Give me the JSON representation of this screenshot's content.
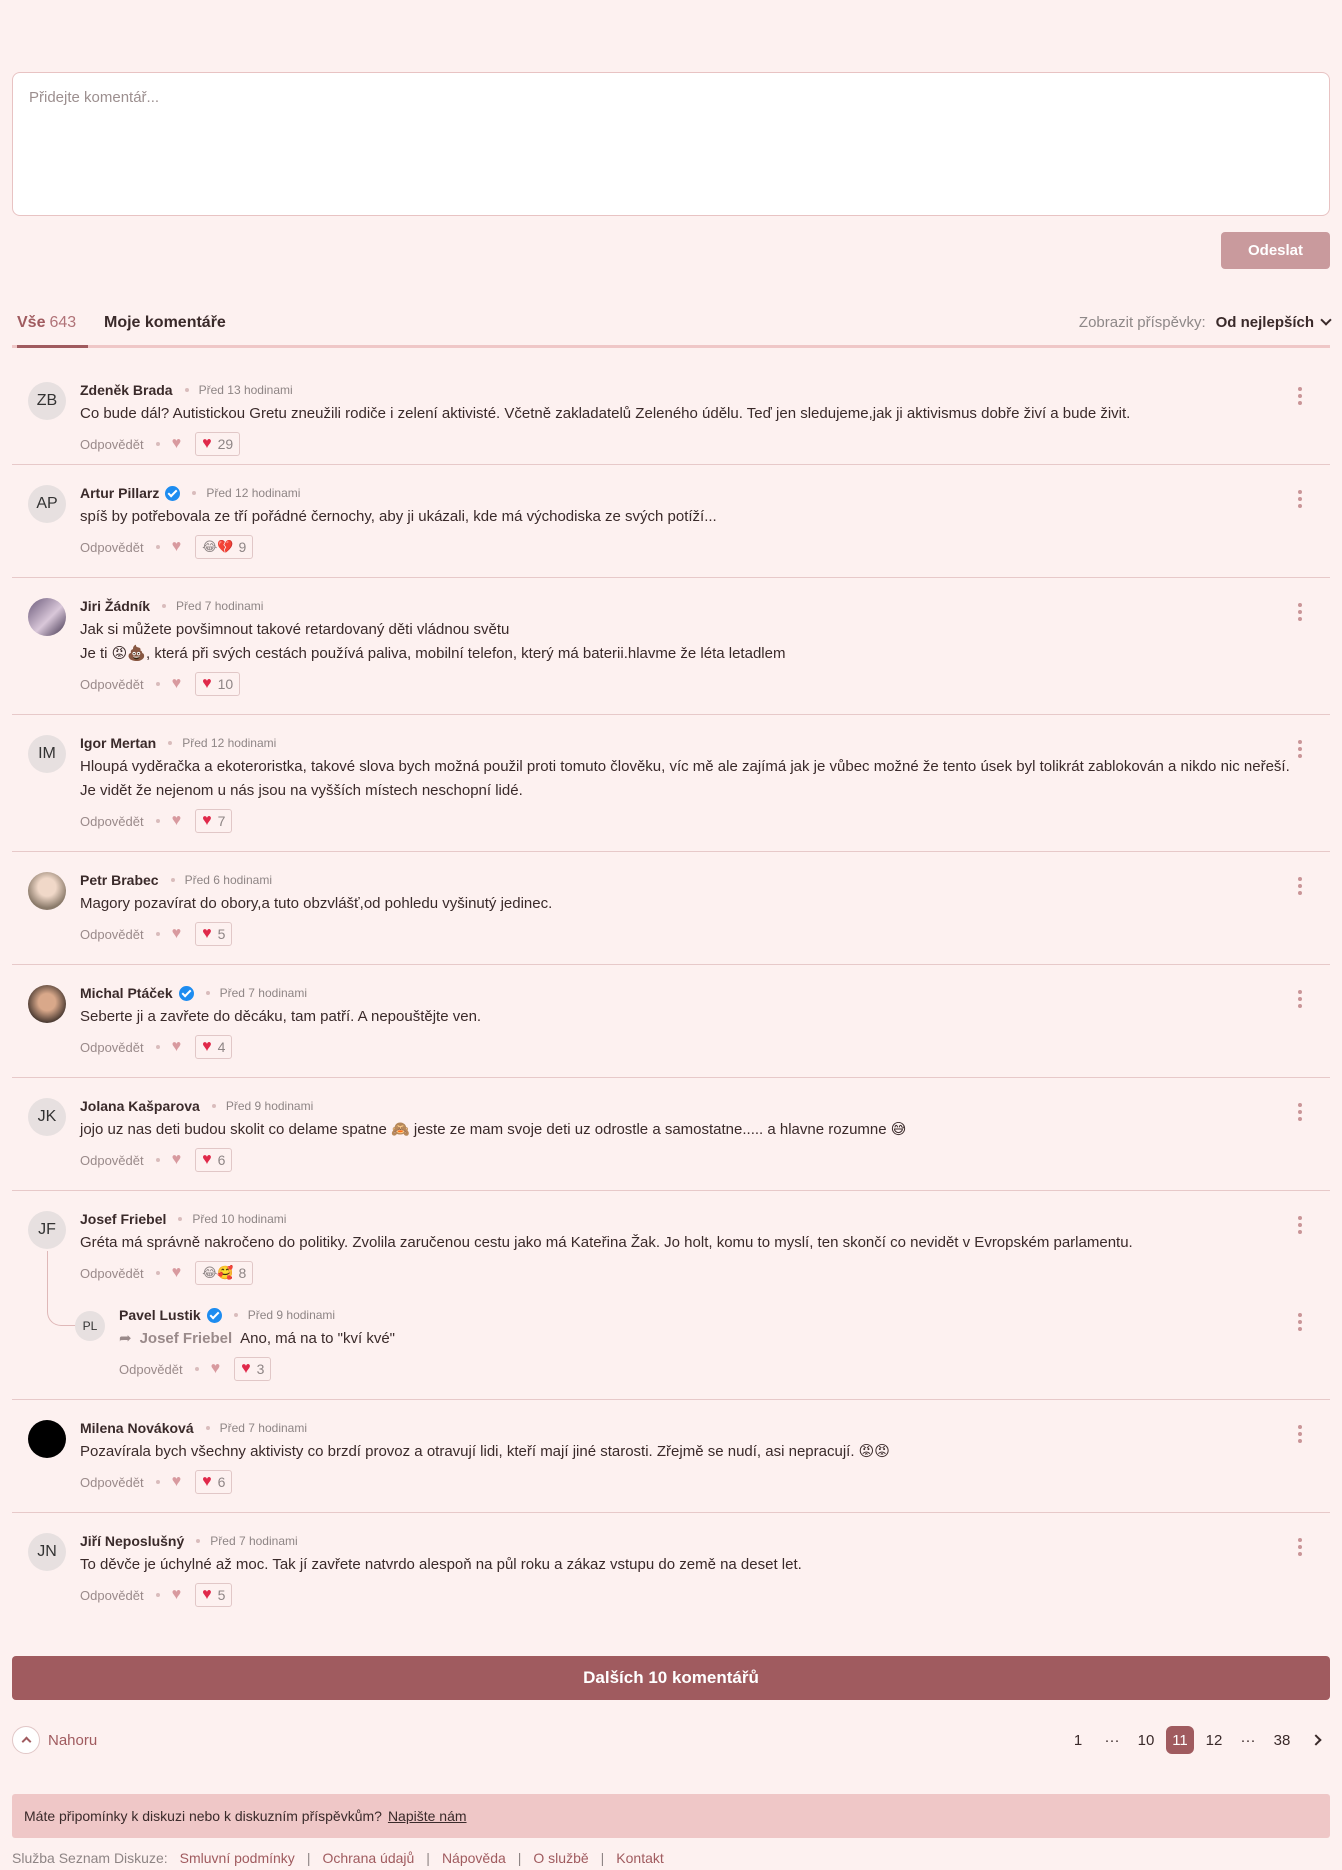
{
  "composer": {
    "placeholder": "Přidejte komentář...",
    "send_label": "Odeslat"
  },
  "tabs": {
    "all_label": "Vše",
    "all_count": "643",
    "mine_label": "Moje komentáře"
  },
  "sort": {
    "label": "Zobrazit příspěvky:",
    "value": "Od nejlepších"
  },
  "comments": [
    {
      "initials": "ZB",
      "name": "Zdeněk Brada",
      "verified": false,
      "time": "Před 13 hodinami",
      "text": [
        "Co bude dál? Autistickou Gretu zneužili rodiče i zelení aktivisté. Včetně zakladatelů Zeleného údělu. Teď jen sledujeme,jak ji aktivismus dobře živí a bude živit."
      ],
      "reply": "Odpovědět",
      "reaction_icons": "heart",
      "reaction_count": "29"
    },
    {
      "initials": "AP",
      "name": "Artur Pillarz",
      "verified": true,
      "time": "Před 12 hodinami",
      "text": [
        "spíš by potřebovala ze tří pořádné černochy, aby ji ukázali, kde má východiska ze svých potíží..."
      ],
      "reply": "Odpovědět",
      "reaction_icons": "😂💔",
      "reaction_count": "9"
    },
    {
      "initials": "",
      "name": "Jiri Žádník",
      "verified": false,
      "time": "Před 7 hodinami",
      "text": [
        "Jak si můžete povšimnout takové retardovaný děti vládnou světu",
        "Je ti 😡💩, která při svých cestách používá paliva, mobilní telefon, který má baterii.hlavme že léta letadlem"
      ],
      "reply": "Odpovědět",
      "reaction_icons": "heart",
      "reaction_count": "10"
    },
    {
      "initials": "IM",
      "name": "Igor Mertan",
      "verified": false,
      "time": "Před 12 hodinami",
      "text": [
        "Hloupá vyděračka a ekoteroristka, takové slova bych možná použil proti tomuto člověku, víc mě ale zajímá jak je vůbec možné že tento úsek byl tolikrát zablokován a nikdo nic neřeší. Je vidět že nejenom u nás jsou na vyšších místech neschopní lidé."
      ],
      "reply": "Odpovědět",
      "reaction_icons": "heart",
      "reaction_count": "7"
    },
    {
      "initials": "",
      "name": "Petr Brabec",
      "verified": false,
      "time": "Před 6 hodinami",
      "text": [
        "Magory pozavírat do obory,a tuto obzvlášť,od pohledu vyšinutý jedinec."
      ],
      "reply": "Odpovědět",
      "reaction_icons": "heart",
      "reaction_count": "5"
    },
    {
      "initials": "",
      "name": "Michal Ptáček",
      "verified": true,
      "time": "Před 7 hodinami",
      "text": [
        "Seberte ji a zavřete do děcáku, tam patří. A nepouštějte ven."
      ],
      "reply": "Odpovědět",
      "reaction_icons": "heart",
      "reaction_count": "4"
    },
    {
      "initials": "JK",
      "name": "Jolana Kašparova",
      "verified": false,
      "time": "Před 9 hodinami",
      "text": [
        "jojo uz nas deti budou skolit co delame spatne 🙈 jeste ze mam svoje deti uz odrostle a samostatne..... a hlavne rozumne 😅"
      ],
      "reply": "Odpovědět",
      "reaction_icons": "heart",
      "reaction_count": "6"
    },
    {
      "initials": "JF",
      "name": "Josef Friebel",
      "verified": false,
      "time": "Před 10 hodinami",
      "text": [
        "Gréta má správně nakročeno do politiky. Zvolila zaručenou cestu jako má Kateřina Žak. Jo holt, komu to myslí, ten skončí co nevidět v Evropském parlamentu."
      ],
      "reply": "Odpovědět",
      "reaction_icons": "😂🥰",
      "reaction_count": "8"
    },
    {
      "initials": "",
      "name": "Milena Nováková",
      "verified": false,
      "time": "Před 7 hodinami",
      "text": [
        "Pozavírala bych všechny aktivisty co brzdí provoz a otravují lidi, kteří mají jiné starosti. Zřejmě se nudí, asi nepracují. 😡😡"
      ],
      "reply": "Odpovědět",
      "reaction_icons": "heart",
      "reaction_count": "6"
    },
    {
      "initials": "JN",
      "name": "Jiří Neposlušný",
      "verified": false,
      "time": "Před 7 hodinami",
      "text": [
        "To děvče je úchylné až moc. Tak jí zavřete natvrdo alespoň na půl roku a zákaz vstupu do země na deset let."
      ],
      "reply": "Odpovědět",
      "reaction_icons": "heart",
      "reaction_count": "5"
    }
  ],
  "nested_reply": {
    "initials": "PL",
    "name": "Pavel Lustik",
    "verified": true,
    "time": "Před 9 hodinami",
    "reply_to": "Josef Friebel",
    "text": "Ano, má na to \"kví kvé\"",
    "reply": "Odpovědět",
    "reaction_count": "3"
  },
  "more_button": "Dalších 10 komentářů",
  "top_link": "Nahoru",
  "pagination": {
    "pages": [
      "1",
      "···",
      "10",
      "11",
      "12",
      "···",
      "38"
    ],
    "current": "11"
  },
  "feedback": {
    "text": "Máte připomínky k diskuzi nebo k diskuzním příspěvkům?",
    "link": "Napište nám"
  },
  "footer": {
    "lead": "Služba Seznam Diskuze:",
    "links": [
      "Smluvní podmínky",
      "Ochrana údajů",
      "Nápověda",
      "O službě",
      "Kontakt"
    ]
  },
  "colors": {
    "background": "#fdf1f0",
    "accent": "#a05b5f",
    "border": "#e7c9c9",
    "heart": "#e0294a",
    "verified": "#1d8cf0"
  }
}
